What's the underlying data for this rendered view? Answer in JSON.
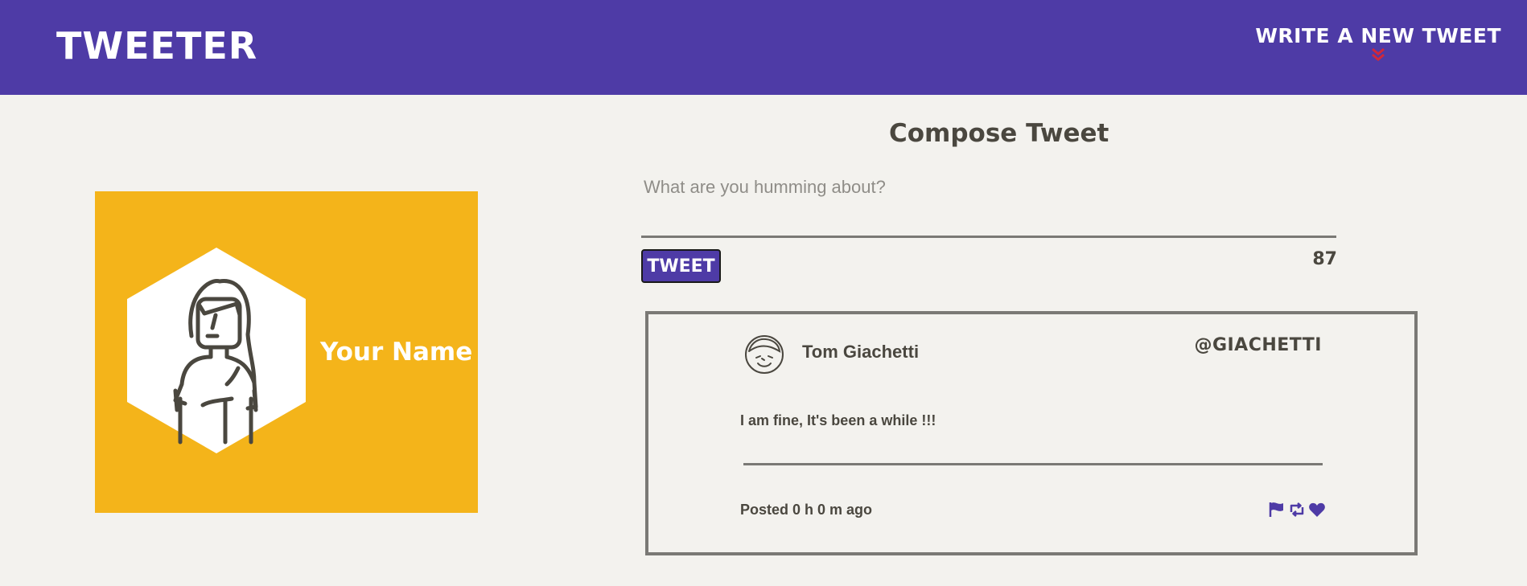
{
  "navbar": {
    "brand": "TWEETER",
    "write_link_label": "WRITE A NEW TWEET",
    "write_link_icon": "double-chevron-down-icon",
    "colors": {
      "background": "#4e3ba6",
      "chevron": "#d0283a"
    }
  },
  "profile": {
    "name": "Your Name",
    "avatar_icon": "woman-avatar-icon",
    "colors": {
      "background": "#f4b41a"
    }
  },
  "compose": {
    "title": "Compose Tweet",
    "placeholder": "What are you humming about?",
    "submit_label": "TWEET",
    "counter": "87"
  },
  "tweets": [
    {
      "author": "Tom Giachetti",
      "handle": "@GIACHETTI",
      "text": "I am fine, It's been a while !!!",
      "posted": "Posted 0 h 0 m ago",
      "avatar_icon": "face-avatar-icon",
      "actions": [
        "flag-icon",
        "retweet-icon",
        "heart-icon"
      ]
    }
  ],
  "theme": {
    "accent": "#4e3ba6",
    "page_background": "#f3f2ee",
    "text": "#4a473f"
  }
}
